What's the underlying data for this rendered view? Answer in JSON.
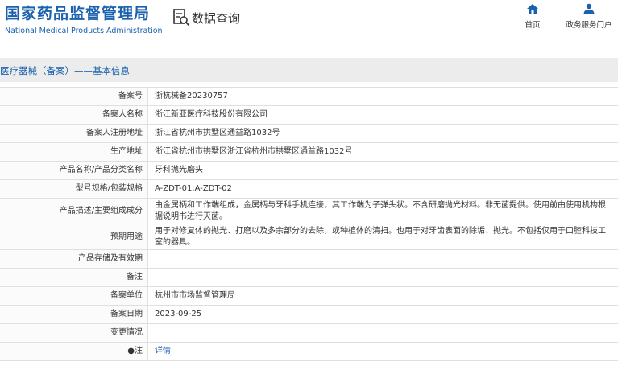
{
  "header": {
    "logo_cn": "国家药品监督管理局",
    "logo_en": "National Medical Products Administration",
    "query_label": "数据查询",
    "nav": [
      {
        "label": "首页",
        "icon": "home-icon"
      },
      {
        "label": "政务服务门户",
        "icon": "user-icon"
      }
    ]
  },
  "section": {
    "title": "医疗器械（备案）——基本信息"
  },
  "rows": [
    {
      "label": "备案号",
      "value": "浙杭械备20230757"
    },
    {
      "label": "备案人名称",
      "value": "浙江新亚医疗科技股份有限公司"
    },
    {
      "label": "备案人注册地址",
      "value": "浙江省杭州市拱墅区通益路1032号"
    },
    {
      "label": "生产地址",
      "value": "浙江省杭州市拱墅区浙江省杭州市拱墅区通益路1032号"
    },
    {
      "label": "产品名称/产品分类名称",
      "value": "牙科抛光磨头"
    },
    {
      "label": "型号规格/包装规格",
      "value": "A-ZDT-01;A-ZDT-02"
    },
    {
      "label": "产品描述/主要组成成分",
      "value": "由金属柄和工作端组成，金属柄与牙科手机连接，其工作端为子弹头状。不含研磨抛光材料。非无菌提供。使用前由使用机构根据说明书进行灭菌。"
    },
    {
      "label": "预期用途",
      "value": "用于对修复体的抛光、打磨以及多余部分的去除，或种植体的清扫。也用于对牙齿表面的除垢、抛光。不包括仅用于口腔科技工室的器具。"
    },
    {
      "label": "产品存储及有效期",
      "value": ""
    },
    {
      "label": "备注",
      "value": ""
    },
    {
      "label": "备案单位",
      "value": "杭州市市场监督管理局"
    },
    {
      "label": "备案日期",
      "value": "2023-09-25"
    },
    {
      "label": "变更情况",
      "value": ""
    },
    {
      "label": "●注",
      "value": "详情"
    }
  ],
  "colors": {
    "brand_blue": "#1a62ad",
    "section_bg": "#ececec",
    "border": "#dfdfdf"
  }
}
